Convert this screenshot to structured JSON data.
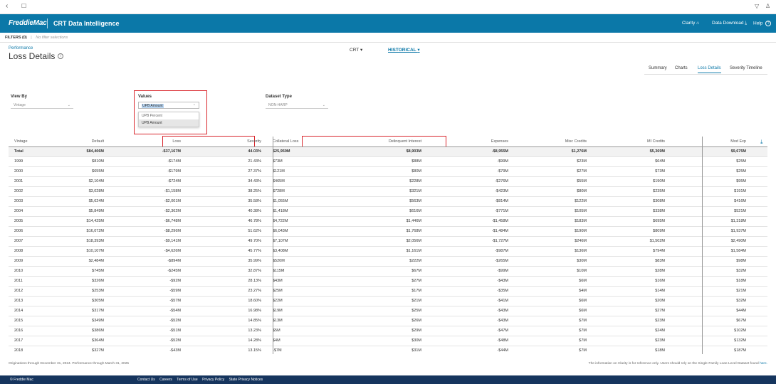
{
  "browser": {
    "back": "‹",
    "bookmark": "☐",
    "filter_icon": "▽",
    "user_icon": "♙"
  },
  "header": {
    "logo": "FreddieMac",
    "title": "CRT Data Intelligence",
    "nav": {
      "clarity": "Clarity",
      "download": "Data Download",
      "help": "Help"
    }
  },
  "filters": {
    "label": "FILTERS (0)",
    "sep": "|",
    "none": "No filter selections"
  },
  "page": {
    "breadcrumb": "Performance",
    "title": "Loss Details",
    "info": "i"
  },
  "toggles": {
    "crt": "CRT",
    "historical": "HISTORICAL"
  },
  "tabs": [
    "Summary",
    "Charts",
    "Loss Details",
    "Severity Timeline"
  ],
  "controls": {
    "view_by": {
      "label": "View By",
      "value": "Vintage"
    },
    "values": {
      "label": "Values",
      "value": "UPB Amount",
      "options": [
        "UPB Percent",
        "UPB Amount"
      ]
    },
    "dataset": {
      "label": "Dataset Type",
      "value": "NON-HARP"
    }
  },
  "table": {
    "columns": [
      "Vintage",
      "Default",
      "Loss",
      "Severity",
      "Collateral Loss",
      "Delinquent Interest",
      "Expenses",
      "Misc Credits",
      "MI Credits",
      "Mod Exp"
    ],
    "total": [
      "Total",
      "$84,406M",
      "-$37,167M",
      "44.03%",
      "$25,959M",
      "$8,903M",
      "-$8,955M",
      "$1,276M",
      "$5,369M",
      "$9,675M"
    ],
    "rows": [
      [
        "1999",
        "$810M",
        "-$174M",
        "21.43%",
        "$73M",
        "$88M",
        "-$99M",
        "$23M",
        "$64M",
        "$25M"
      ],
      [
        "2000",
        "$655M",
        "-$179M",
        "27.37%",
        "$121M",
        "$80M",
        "-$79M",
        "$27M",
        "$73M",
        "$25M"
      ],
      [
        "2001",
        "$2,104M",
        "-$724M",
        "34.43%",
        "$465M",
        "$228M",
        "-$276M",
        "$55M",
        "$190M",
        "$95M"
      ],
      [
        "2002",
        "$3,028M",
        "-$1,158M",
        "38.25%",
        "$728M",
        "$321M",
        "-$423M",
        "$80M",
        "$235M",
        "$191M"
      ],
      [
        "2003",
        "$5,624M",
        "-$2,001M",
        "35.58%",
        "$1,055M",
        "$563M",
        "-$814M",
        "$122M",
        "$308M",
        "$416M"
      ],
      [
        "2004",
        "$5,849M",
        "-$2,362M",
        "40.38%",
        "$1,418M",
        "$616M",
        "-$771M",
        "$105M",
        "$338M",
        "$521M"
      ],
      [
        "2005",
        "$14,425M",
        "-$6,748M",
        "46.78%",
        "$4,722M",
        "$1,446M",
        "-$1,458M",
        "$183M",
        "$695M",
        "$1,318M"
      ],
      [
        "2006",
        "$16,072M",
        "-$8,296M",
        "51.62%",
        "$6,043M",
        "$1,768M",
        "-$1,484M",
        "$190M",
        "$809M",
        "$1,937M"
      ],
      [
        "2007",
        "$18,393M",
        "-$9,141M",
        "49.70%",
        "$7,107M",
        "$2,056M",
        "-$1,727M",
        "$246M",
        "$1,502M",
        "$2,490M"
      ],
      [
        "2008",
        "$10,107M",
        "-$4,626M",
        "45.77%",
        "$3,408M",
        "$1,161M",
        "-$987M",
        "$136M",
        "$794M",
        "$1,584M"
      ],
      [
        "2009",
        "$2,484M",
        "-$894M",
        "35.99%",
        "$520M",
        "$222M",
        "-$265M",
        "$30M",
        "$83M",
        "$98M"
      ],
      [
        "2010",
        "$745M",
        "-$245M",
        "32.87%",
        "$115M",
        "$67M",
        "-$99M",
        "$10M",
        "$28M",
        "$32M"
      ],
      [
        "2011",
        "$326M",
        "-$92M",
        "28.13%",
        "$43M",
        "$27M",
        "-$43M",
        "$6M",
        "$16M",
        "$18M"
      ],
      [
        "2012",
        "$253M",
        "-$59M",
        "23.27%",
        "$25M",
        "$17M",
        "-$35M",
        "$4M",
        "$14M",
        "$21M"
      ],
      [
        "2013",
        "$305M",
        "-$57M",
        "18.60%",
        "$22M",
        "$21M",
        "-$41M",
        "$6M",
        "$20M",
        "$32M"
      ],
      [
        "2014",
        "$317M",
        "-$54M",
        "16.98%",
        "$19M",
        "$25M",
        "-$43M",
        "$6M",
        "$27M",
        "$44M"
      ],
      [
        "2015",
        "$349M",
        "-$52M",
        "14.85%",
        "$13M",
        "$26M",
        "-$43M",
        "$7M",
        "$23M",
        "$67M"
      ],
      [
        "2016",
        "$386M",
        "-$51M",
        "13.23%",
        "$5M",
        "$29M",
        "-$47M",
        "$7M",
        "$24M",
        "$102M"
      ],
      [
        "2017",
        "$364M",
        "-$52M",
        "14.28%",
        "$4M",
        "$30M",
        "-$48M",
        "$7M",
        "$23M",
        "$132M"
      ],
      [
        "2018",
        "$327M",
        "-$43M",
        "13.15%",
        "-$7M",
        "$31M",
        "-$44M",
        "$7M",
        "$18M",
        "$187M"
      ]
    ]
  },
  "footnote": {
    "left": "Originations through December 31, 2024. Performance through March 31, 2025",
    "right": "The information on Clarity is for reference only. Users should rely on the Single-Family Loan-Level Dataset found",
    "link": "here."
  },
  "footer": {
    "copyright": "© Freddie Mac",
    "links": [
      "Contact Us",
      "Careers",
      "Terms of Use",
      "Privacy Policy",
      "State Privacy Notices"
    ]
  },
  "colors": {
    "brand": "#0b78a8",
    "footer": "#16355e",
    "highlight": "#d9262c"
  }
}
